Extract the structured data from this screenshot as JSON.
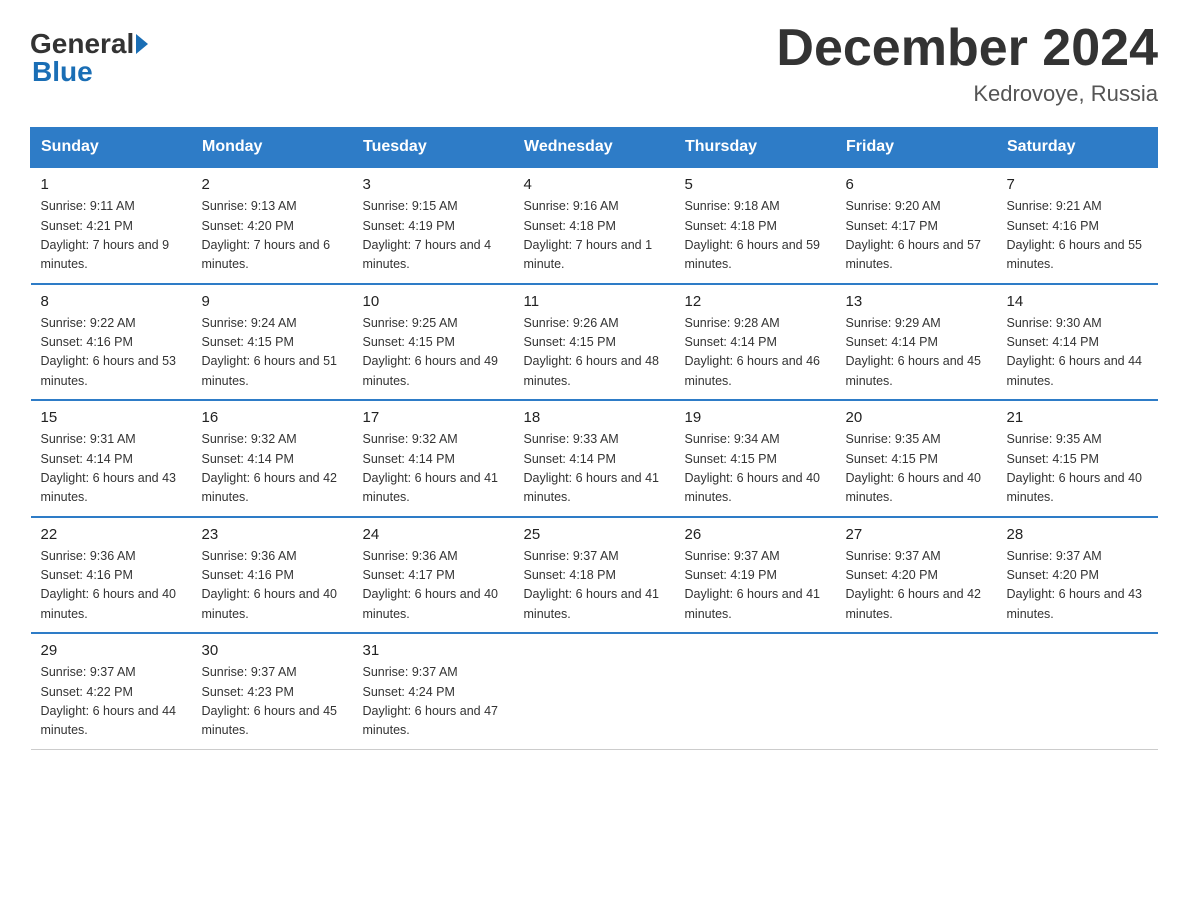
{
  "logo": {
    "line1": "General",
    "arrow": "▶",
    "line2": "Blue"
  },
  "title": "December 2024",
  "location": "Kedrovoye, Russia",
  "days_of_week": [
    "Sunday",
    "Monday",
    "Tuesday",
    "Wednesday",
    "Thursday",
    "Friday",
    "Saturday"
  ],
  "weeks": [
    [
      {
        "day": "1",
        "sunrise": "9:11 AM",
        "sunset": "4:21 PM",
        "daylight": "7 hours and 9 minutes."
      },
      {
        "day": "2",
        "sunrise": "9:13 AM",
        "sunset": "4:20 PM",
        "daylight": "7 hours and 6 minutes."
      },
      {
        "day": "3",
        "sunrise": "9:15 AM",
        "sunset": "4:19 PM",
        "daylight": "7 hours and 4 minutes."
      },
      {
        "day": "4",
        "sunrise": "9:16 AM",
        "sunset": "4:18 PM",
        "daylight": "7 hours and 1 minute."
      },
      {
        "day": "5",
        "sunrise": "9:18 AM",
        "sunset": "4:18 PM",
        "daylight": "6 hours and 59 minutes."
      },
      {
        "day": "6",
        "sunrise": "9:20 AM",
        "sunset": "4:17 PM",
        "daylight": "6 hours and 57 minutes."
      },
      {
        "day": "7",
        "sunrise": "9:21 AM",
        "sunset": "4:16 PM",
        "daylight": "6 hours and 55 minutes."
      }
    ],
    [
      {
        "day": "8",
        "sunrise": "9:22 AM",
        "sunset": "4:16 PM",
        "daylight": "6 hours and 53 minutes."
      },
      {
        "day": "9",
        "sunrise": "9:24 AM",
        "sunset": "4:15 PM",
        "daylight": "6 hours and 51 minutes."
      },
      {
        "day": "10",
        "sunrise": "9:25 AM",
        "sunset": "4:15 PM",
        "daylight": "6 hours and 49 minutes."
      },
      {
        "day": "11",
        "sunrise": "9:26 AM",
        "sunset": "4:15 PM",
        "daylight": "6 hours and 48 minutes."
      },
      {
        "day": "12",
        "sunrise": "9:28 AM",
        "sunset": "4:14 PM",
        "daylight": "6 hours and 46 minutes."
      },
      {
        "day": "13",
        "sunrise": "9:29 AM",
        "sunset": "4:14 PM",
        "daylight": "6 hours and 45 minutes."
      },
      {
        "day": "14",
        "sunrise": "9:30 AM",
        "sunset": "4:14 PM",
        "daylight": "6 hours and 44 minutes."
      }
    ],
    [
      {
        "day": "15",
        "sunrise": "9:31 AM",
        "sunset": "4:14 PM",
        "daylight": "6 hours and 43 minutes."
      },
      {
        "day": "16",
        "sunrise": "9:32 AM",
        "sunset": "4:14 PM",
        "daylight": "6 hours and 42 minutes."
      },
      {
        "day": "17",
        "sunrise": "9:32 AM",
        "sunset": "4:14 PM",
        "daylight": "6 hours and 41 minutes."
      },
      {
        "day": "18",
        "sunrise": "9:33 AM",
        "sunset": "4:14 PM",
        "daylight": "6 hours and 41 minutes."
      },
      {
        "day": "19",
        "sunrise": "9:34 AM",
        "sunset": "4:15 PM",
        "daylight": "6 hours and 40 minutes."
      },
      {
        "day": "20",
        "sunrise": "9:35 AM",
        "sunset": "4:15 PM",
        "daylight": "6 hours and 40 minutes."
      },
      {
        "day": "21",
        "sunrise": "9:35 AM",
        "sunset": "4:15 PM",
        "daylight": "6 hours and 40 minutes."
      }
    ],
    [
      {
        "day": "22",
        "sunrise": "9:36 AM",
        "sunset": "4:16 PM",
        "daylight": "6 hours and 40 minutes."
      },
      {
        "day": "23",
        "sunrise": "9:36 AM",
        "sunset": "4:16 PM",
        "daylight": "6 hours and 40 minutes."
      },
      {
        "day": "24",
        "sunrise": "9:36 AM",
        "sunset": "4:17 PM",
        "daylight": "6 hours and 40 minutes."
      },
      {
        "day": "25",
        "sunrise": "9:37 AM",
        "sunset": "4:18 PM",
        "daylight": "6 hours and 41 minutes."
      },
      {
        "day": "26",
        "sunrise": "9:37 AM",
        "sunset": "4:19 PM",
        "daylight": "6 hours and 41 minutes."
      },
      {
        "day": "27",
        "sunrise": "9:37 AM",
        "sunset": "4:20 PM",
        "daylight": "6 hours and 42 minutes."
      },
      {
        "day": "28",
        "sunrise": "9:37 AM",
        "sunset": "4:20 PM",
        "daylight": "6 hours and 43 minutes."
      }
    ],
    [
      {
        "day": "29",
        "sunrise": "9:37 AM",
        "sunset": "4:22 PM",
        "daylight": "6 hours and 44 minutes."
      },
      {
        "day": "30",
        "sunrise": "9:37 AM",
        "sunset": "4:23 PM",
        "daylight": "6 hours and 45 minutes."
      },
      {
        "day": "31",
        "sunrise": "9:37 AM",
        "sunset": "4:24 PM",
        "daylight": "6 hours and 47 minutes."
      },
      null,
      null,
      null,
      null
    ]
  ]
}
